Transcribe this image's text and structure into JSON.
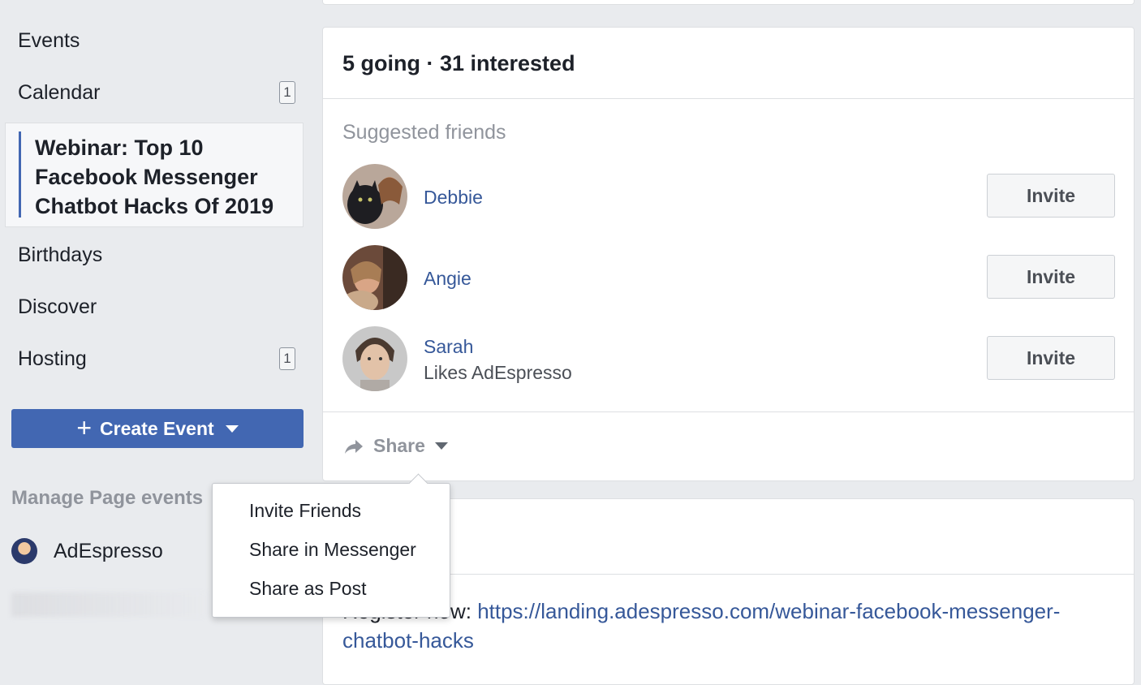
{
  "sidebar": {
    "events_label": "Events",
    "calendar_label": "Calendar",
    "calendar_badge": "1",
    "active_event_title": "Webinar: Top 10 Facebook Messenger Chatbot Hacks Of 2019",
    "birthdays_label": "Birthdays",
    "discover_label": "Discover",
    "hosting_label": "Hosting",
    "hosting_badge": "1",
    "create_event_label": "Create Event",
    "manage_section_label": "Manage Page events",
    "page_name": "AdEspresso"
  },
  "guests": {
    "stats": "5 going · 31 interested",
    "suggested_heading": "Suggested friends",
    "friends": [
      {
        "name": "Debbie",
        "subtitle": "",
        "invite_label": "Invite"
      },
      {
        "name": "Angie",
        "subtitle": "",
        "invite_label": "Invite"
      },
      {
        "name": "Sarah",
        "subtitle": "Likes AdEspresso",
        "invite_label": "Invite"
      }
    ],
    "share_label": "Share"
  },
  "share_menu": {
    "items": [
      "Invite Friends",
      "Share in Messenger",
      "Share as Post"
    ]
  },
  "details": {
    "link_prefix": "Register now: ",
    "link_url": "https://landing.adespresso.com/webinar-facebook-messenger-chatbot-hacks"
  },
  "colors": {
    "brand_blue": "#4267b2",
    "link_blue": "#365899",
    "background": "#e9ebee"
  }
}
